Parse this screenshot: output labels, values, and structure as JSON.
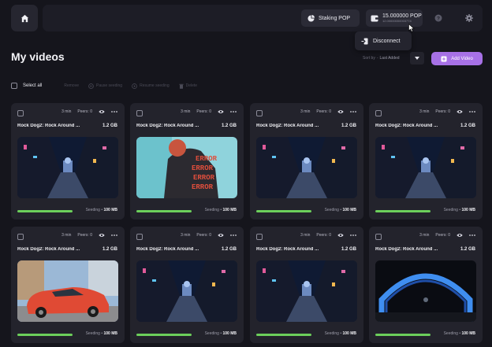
{
  "header": {
    "staking_label": "Staking POP",
    "balance": "15.000000 POP",
    "balance_sub": "12.00000000003774",
    "disconnect_label": "Disconnect"
  },
  "page": {
    "title": "My videos",
    "sort_label": "Sort by",
    "sort_value": "Last Added",
    "add_video_label": "Add Video"
  },
  "toolbar": {
    "select_all": "Select all",
    "actions": [
      "Remove",
      "Pause seeding",
      "Resume seeding",
      "Delete"
    ]
  },
  "videos": [
    {
      "title": "Rock Dog2: Rock Around ...",
      "size": "1.2 GB",
      "duration": "3 min",
      "peers": "Peers: 0",
      "status": "Seeding",
      "amount": "100 MB",
      "progress": 1.0,
      "thumb": "alley"
    },
    {
      "title": "Rock Dog2: Rock Around ...",
      "size": "1.2 GB",
      "duration": "3 min",
      "peers": "Peers: 0",
      "status": "Seeding",
      "amount": "100 MB",
      "progress": 1.0,
      "thumb": "error"
    },
    {
      "title": "Rock Dog2: Rock Around ...",
      "size": "1.2 GB",
      "duration": "3 min",
      "peers": "Peers: 0",
      "status": "Seeding",
      "amount": "100 MB",
      "progress": 1.0,
      "thumb": "alley"
    },
    {
      "title": "Rock Dog2: Rock Around ...",
      "size": "1.2 GB",
      "duration": "3 min",
      "peers": "Peers: 0",
      "status": "Seeding",
      "amount": "100 MB",
      "progress": 1.0,
      "thumb": "alley"
    },
    {
      "title": "Rock Dog2: Rock Around ...",
      "size": "1.2 GB",
      "duration": "3 min",
      "peers": "Peers: 0",
      "status": "Seeding",
      "amount": "100 MB",
      "progress": 1.0,
      "thumb": "car"
    },
    {
      "title": "Rock Dog2: Rock Around ...",
      "size": "1.2 GB",
      "duration": "3 min",
      "peers": "Peers: 0",
      "status": "Seeding",
      "amount": "100 MB",
      "progress": 1.0,
      "thumb": "alley"
    },
    {
      "title": "Rock Dog2: Rock Around ...",
      "size": "1.2 GB",
      "duration": "3 min",
      "peers": "Peers: 0",
      "status": "Seeding",
      "amount": "100 MB",
      "progress": 1.0,
      "thumb": "alley"
    },
    {
      "title": "Rock Dog2: Rock Around ...",
      "size": "1.2 GB",
      "duration": "3 min",
      "peers": "Peers: 0",
      "status": "Seeding",
      "amount": "100 MB",
      "progress": 1.0,
      "thumb": "arch"
    }
  ],
  "thumbnail_text": "ERROR",
  "colors": {
    "background": "#15151c",
    "card": "#23232c",
    "accent": "#a771e6",
    "progress": "#6ccf5b"
  }
}
